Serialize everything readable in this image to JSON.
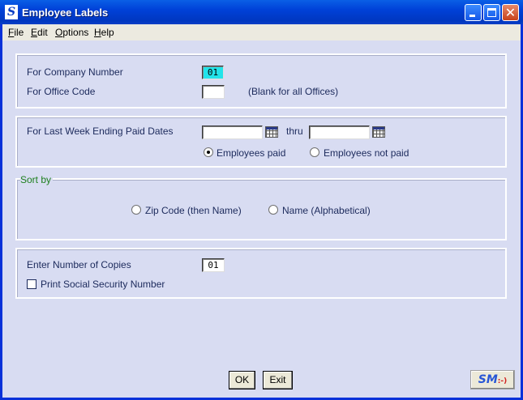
{
  "window": {
    "title": "Employee Labels",
    "logo_letter": "S"
  },
  "menu": [
    {
      "label": "File",
      "hotkey": "F",
      "rest": "ile"
    },
    {
      "label": "Edit",
      "hotkey": "E",
      "rest": "dit"
    },
    {
      "label": "Options",
      "hotkey": "O",
      "rest": "ptions"
    },
    {
      "label": "Help",
      "hotkey": "H",
      "rest": "elp"
    }
  ],
  "company": {
    "number_label": "For Company Number",
    "number_value": "01",
    "office_label": "For Office Code",
    "office_value": "",
    "office_hint": "(Blank for all Offices)"
  },
  "dates": {
    "label": "For Last Week Ending Paid Dates",
    "from_value": "",
    "thru_label": "thru",
    "to_value": "",
    "options": [
      {
        "label": "Employees paid",
        "selected": true
      },
      {
        "label": "Employees not paid",
        "selected": false
      }
    ]
  },
  "sort": {
    "legend": "Sort by",
    "options": [
      {
        "label": "Zip Code (then Name)",
        "selected": false
      },
      {
        "label": "Name (Alphabetical)",
        "selected": false
      }
    ]
  },
  "copies": {
    "label": "Enter Number of Copies",
    "value": "01",
    "ssn_label": "Print Social Security Number",
    "ssn_checked": false
  },
  "buttons": {
    "ok": "OK",
    "exit": "Exit",
    "logo_text": "SM",
    "logo_face": ":-)"
  },
  "icons": [
    "calendar-icon",
    "minimize-icon",
    "maximize-icon",
    "close-icon"
  ]
}
